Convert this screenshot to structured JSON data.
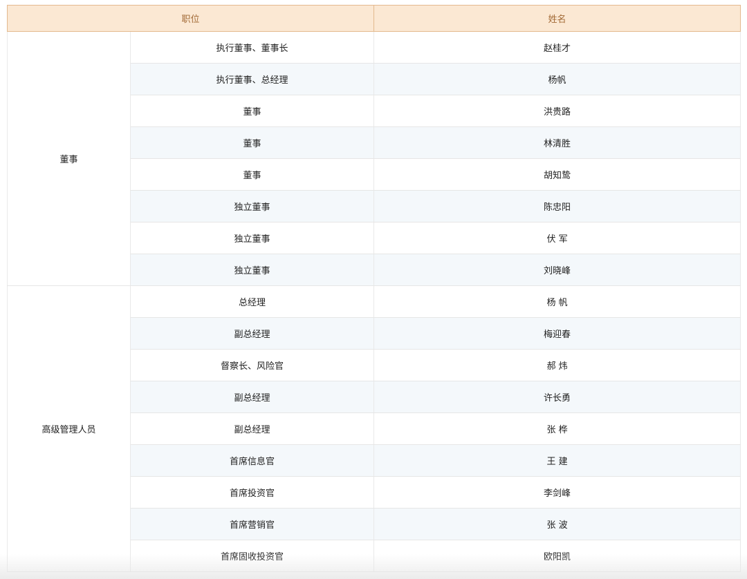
{
  "table": {
    "headers": {
      "position": "职位",
      "name": "姓名"
    },
    "groups": [
      {
        "label": "董事",
        "rows": [
          {
            "position": "执行董事、董事长",
            "name": "赵桂才"
          },
          {
            "position": "执行董事、总经理",
            "name": "杨帆"
          },
          {
            "position": "董事",
            "name": "洪贵路"
          },
          {
            "position": "董事",
            "name": "林清胜"
          },
          {
            "position": "董事",
            "name": "胡知鸷"
          },
          {
            "position": "独立董事",
            "name": "陈忠阳"
          },
          {
            "position": "独立董事",
            "name": "伏 军"
          },
          {
            "position": "独立董事",
            "name": "刘晓峰"
          }
        ]
      },
      {
        "label": "高级管理人员",
        "rows": [
          {
            "position": "总经理",
            "name": "杨 帆"
          },
          {
            "position": "副总经理",
            "name": "梅迎春"
          },
          {
            "position": "督察长、风险官",
            "name": "郝 炜"
          },
          {
            "position": "副总经理",
            "name": "许长勇"
          },
          {
            "position": "副总经理",
            "name": "张 桦"
          },
          {
            "position": "首席信息官",
            "name": "王 建"
          },
          {
            "position": "首席投资官",
            "name": "李剑峰"
          },
          {
            "position": "首席营销官",
            "name": "张 波"
          },
          {
            "position": "首席固收投资官",
            "name": "欧阳凯"
          }
        ]
      }
    ]
  }
}
